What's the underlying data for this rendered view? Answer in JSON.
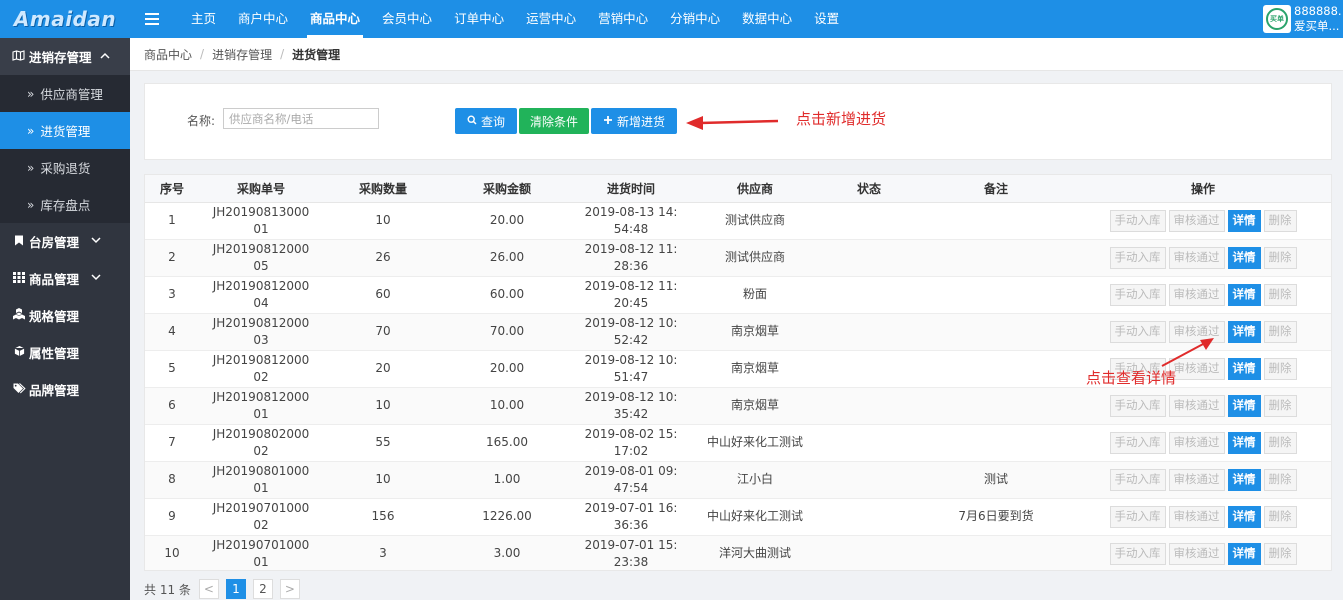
{
  "app": {
    "logo": "Amaidan"
  },
  "topnav": [
    "主页",
    "商户中心",
    "商品中心",
    "会员中心",
    "订单中心",
    "运营中心",
    "营销中心",
    "分销中心",
    "数据中心",
    "设置"
  ],
  "topnav_active": 2,
  "user": {
    "line1": "888888...",
    "line2": "爱买单...",
    "avatar_text": "买单"
  },
  "sidebar": {
    "group": {
      "label": "进销存管理",
      "chevron": "^"
    },
    "sub_items": [
      {
        "label": "供应商管理",
        "active": false
      },
      {
        "label": "进货管理",
        "active": true
      },
      {
        "label": "采购退货",
        "active": false
      },
      {
        "label": "库存盘点",
        "active": false
      }
    ],
    "items": [
      {
        "label": "台房管理",
        "icon": "bookmark-icon",
        "chevron": "v"
      },
      {
        "label": "商品管理",
        "icon": "grid-icon",
        "chevron": "v"
      },
      {
        "label": "规格管理",
        "icon": "cubes-icon"
      },
      {
        "label": "属性管理",
        "icon": "cube-icon"
      },
      {
        "label": "品牌管理",
        "icon": "tags-icon"
      }
    ]
  },
  "breadcrumb": [
    "商品中心",
    "进销存管理",
    "进货管理"
  ],
  "filter": {
    "name_label": "名称:",
    "name_placeholder": "供应商名称/电话",
    "search_label": "查询",
    "clear_label": "清除条件",
    "add_label": "新增进货"
  },
  "annotations": {
    "add": "点击新增进货",
    "detail": "点击查看详情"
  },
  "colors": {
    "primary": "#1e8fe6",
    "success": "#21b35a",
    "annotation": "#e02b2b",
    "sidebar": "#30353f"
  },
  "table": {
    "headers": [
      "序号",
      "采购单号",
      "采购数量",
      "采购金额",
      "进货时间",
      "供应商",
      "状态",
      "备注",
      "操作"
    ],
    "ops": [
      "手动入库",
      "审核通过",
      "详情",
      "删除"
    ],
    "rows": [
      {
        "no": "1",
        "order": "JH2019081300001",
        "qty": "10",
        "amount": "20.00",
        "time": "2019-08-13 14:54:48",
        "supplier": "测试供应商",
        "status": "",
        "note": ""
      },
      {
        "no": "2",
        "order": "JH2019081200005",
        "qty": "26",
        "amount": "26.00",
        "time": "2019-08-12 11:28:36",
        "supplier": "测试供应商",
        "status": "",
        "note": ""
      },
      {
        "no": "3",
        "order": "JH2019081200004",
        "qty": "60",
        "amount": "60.00",
        "time": "2019-08-12 11:20:45",
        "supplier": "粉面",
        "status": "",
        "note": ""
      },
      {
        "no": "4",
        "order": "JH2019081200003",
        "qty": "70",
        "amount": "70.00",
        "time": "2019-08-12 10:52:42",
        "supplier": "南京烟草",
        "status": "",
        "note": ""
      },
      {
        "no": "5",
        "order": "JH2019081200002",
        "qty": "20",
        "amount": "20.00",
        "time": "2019-08-12 10:51:47",
        "supplier": "南京烟草",
        "status": "",
        "note": ""
      },
      {
        "no": "6",
        "order": "JH2019081200001",
        "qty": "10",
        "amount": "10.00",
        "time": "2019-08-12 10:35:42",
        "supplier": "南京烟草",
        "status": "",
        "note": ""
      },
      {
        "no": "7",
        "order": "JH2019080200002",
        "qty": "55",
        "amount": "165.00",
        "time": "2019-08-02 15:17:02",
        "supplier": "中山好来化工测试",
        "status": "",
        "note": ""
      },
      {
        "no": "8",
        "order": "JH2019080100001",
        "qty": "10",
        "amount": "1.00",
        "time": "2019-08-01 09:47:54",
        "supplier": "江小白",
        "status": "",
        "note": "测试"
      },
      {
        "no": "9",
        "order": "JH2019070100002",
        "qty": "156",
        "amount": "1226.00",
        "time": "2019-07-01 16:36:36",
        "supplier": "中山好来化工测试",
        "status": "",
        "note": "7月6日要到货"
      },
      {
        "no": "10",
        "order": "JH2019070100001",
        "qty": "3",
        "amount": "3.00",
        "time": "2019-07-01 15:23:38",
        "supplier": "洋河大曲测试",
        "status": "",
        "note": ""
      }
    ]
  },
  "pager": {
    "total": "共 11 条",
    "prev": "<",
    "next": ">",
    "pages": [
      "1",
      "2"
    ],
    "current": "1"
  }
}
